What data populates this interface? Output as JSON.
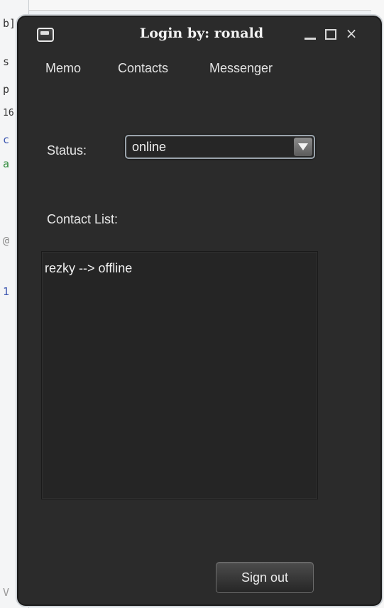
{
  "background": {
    "code_fragments": [
      "b]",
      "s",
      "p",
      "16",
      "c",
      "a",
      "@",
      "1",
      "V"
    ]
  },
  "window": {
    "title": "Login by: ronald",
    "close_glyph": "×"
  },
  "menu": {
    "items": [
      {
        "label": "Memo"
      },
      {
        "label": "Contacts"
      },
      {
        "label": "Messenger"
      }
    ]
  },
  "status": {
    "label": "Status:",
    "selected_value": "online"
  },
  "contacts": {
    "label": "Contact List:",
    "entries": [
      "rezky --> offline"
    ]
  },
  "actions": {
    "signout_label": "Sign out"
  },
  "colors": {
    "window_bg": "#2b2b2b",
    "text": "#e8e8e8",
    "listbox_bg": "#252525"
  },
  "icons": [
    "app-icon",
    "minimize-icon",
    "maximize-icon",
    "close-icon",
    "dropdown-arrow-icon"
  ]
}
